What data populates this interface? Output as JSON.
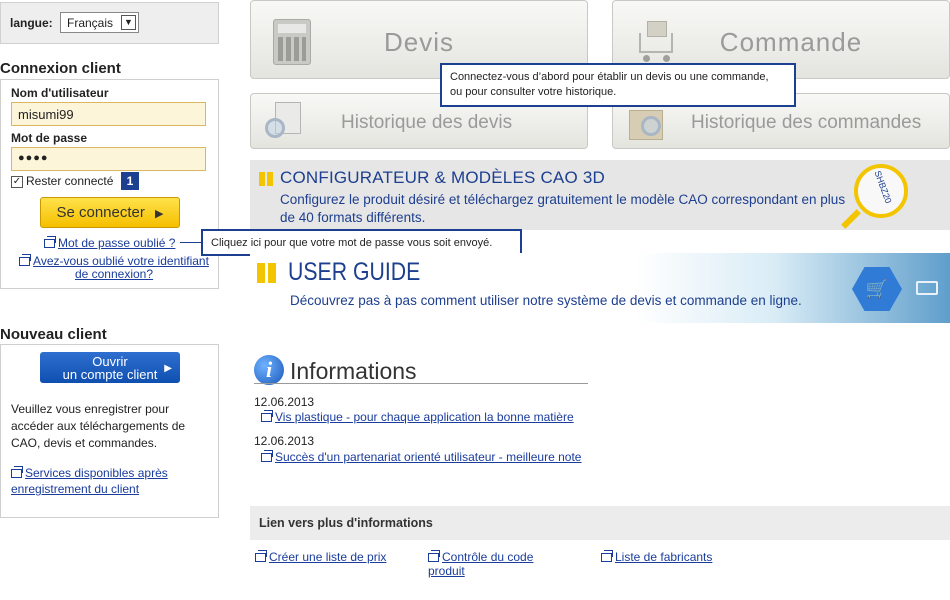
{
  "language": {
    "label": "langue:",
    "selected": "Français"
  },
  "login": {
    "title": "Connexion client",
    "username_label": "Nom d'utilisateur",
    "username_value": "misumi99",
    "password_label": "Mot de passe",
    "password_value": "●●●●",
    "remember_label": "Rester connecté",
    "remember_badge": "1",
    "submit_label": "Se connecter",
    "forgot_password": "Mot de passe oublié ?",
    "forgot_id_line1": "Avez-vous oublié votre identifiant",
    "forgot_id_line2": "de connexion?"
  },
  "new_client": {
    "title": "Nouveau client",
    "button_line1": "Ouvrir",
    "button_line2": "un compte client",
    "description": "Veuillez vous enregistrer pour accéder aux téléchargements de CAO, devis et commandes.",
    "services_link_line1": "Services disponibles après",
    "services_link_line2": "enregistrement du client"
  },
  "tiles": {
    "devis": "Devis",
    "commande": "Commande",
    "historique_devis": "Historique des devis",
    "historique_commandes": "Historique des commandes"
  },
  "callouts": {
    "tiles_tip_line1": "Connectez-vous d’abord pour établir un devis ou une commande,",
    "tiles_tip_line2": "ou pour consulter votre historique.",
    "password_tip": "Cliquez ici pour que votre mot de passe vous soit envoyé."
  },
  "configurator": {
    "title": "CONFIGURATEUR & MODÈLES CAO 3D",
    "text_line1": "Configurez le produit désiré et téléchargez gratuitement le modèle CAO correspondant en plus",
    "text_line2": "de 40 formats différents.",
    "magnifier_text": "SHBZ20"
  },
  "user_guide": {
    "title": "USER GUIDE",
    "text": "Découvrez pas à pas comment utiliser notre système de devis et commande en ligne."
  },
  "informations": {
    "title": "Informations",
    "items": [
      {
        "date": "12.06.2013",
        "link": "Vis plastique - pour chaque application la bonne matière"
      },
      {
        "date": "12.06.2013",
        "link": "Succès d'un partenariat orienté utilisateur - meilleure note"
      }
    ]
  },
  "more_links": {
    "title": "Lien vers plus d'informations",
    "links": [
      "Créer une liste de prix",
      "Contrôle du code produit",
      "Liste de fabricants"
    ]
  },
  "colors": {
    "accent_blue": "#1d3f8f",
    "link_blue": "#1a3c9c",
    "button_yellow": "#f5bf00",
    "marker_yellow": "#f3c500"
  }
}
